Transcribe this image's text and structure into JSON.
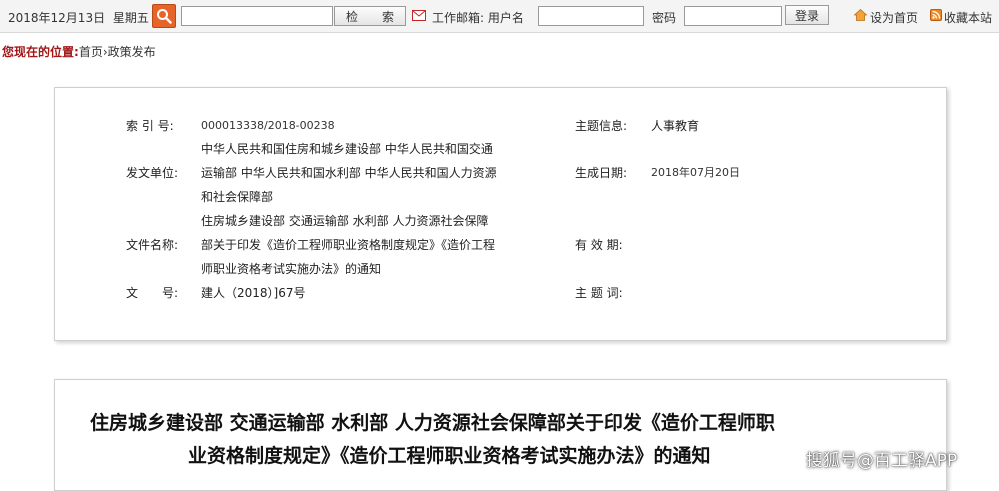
{
  "topbar": {
    "date": "2018年12月13日",
    "weekday": "星期五",
    "search_value": "",
    "search_button": "检　　索",
    "mail_label": "工作邮箱: 用户名",
    "username_value": "",
    "password_label": "密码",
    "password_value": "",
    "login_button": "登录",
    "set_home": "设为首页",
    "bookmark": "收藏本站"
  },
  "breadcrumb": {
    "label": "您现在的位置:",
    "path": "首页›政策发布"
  },
  "info": {
    "index_label": "索 引 号:",
    "index_value": "000013338/2018-00238",
    "topic_label": "主题信息:",
    "topic_value": "人事教育",
    "issuer_label": "发文单位:",
    "issuer_lines": [
      "中华人民共和国住房和城乡建设部 中华人民共和国交通",
      "运输部 中华人民共和国水利部 中华人民共和国人力资源",
      "和社会保障部"
    ],
    "date_label": "生成日期:",
    "date_value": "2018年07月20日",
    "name_label": "文件名称:",
    "name_lines": [
      "住房城乡建设部 交通运输部 水利部 人力资源社会保障",
      "部关于印发《造价工程师职业资格制度规定》《造价工程",
      "师职业资格考试实施办法》的通知"
    ],
    "valid_label": "有 效 期:",
    "docno_label": "文　　号:",
    "docno_value": "建人（2018）]67号",
    "subject_label": "主 题 词:"
  },
  "title": {
    "line1": "住房城乡建设部 交通运输部 水利部 人力资源社会保障部关于印发《造价工程师职",
    "line2": "业资格制度规定》《造价工程师职业资格考试实施办法》的通知"
  },
  "watermark": "搜狐号@百工驿APP"
}
